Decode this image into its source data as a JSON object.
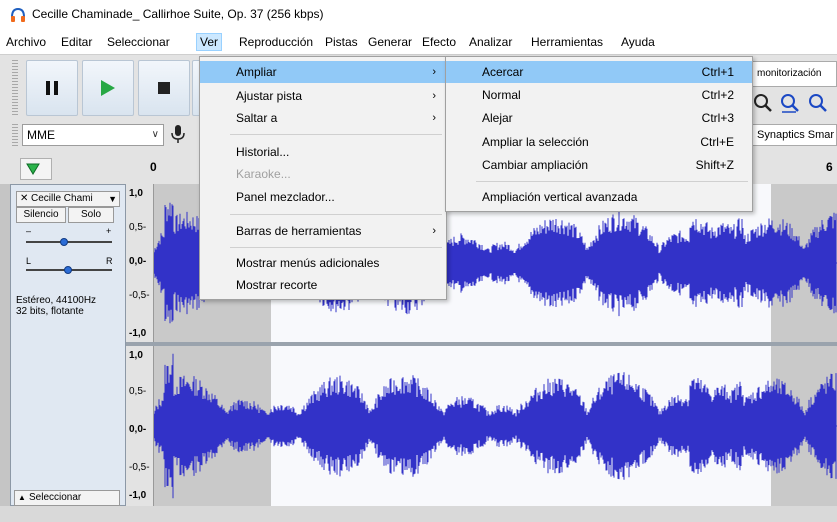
{
  "window": {
    "title": "Cecille Chaminade_ Callirhoe Suite, Op. 37 (256 kbps)"
  },
  "menubar": [
    "Archivo",
    "Editar",
    "Seleccionar",
    "Ver",
    "Reproducción",
    "Pistas",
    "Generar",
    "Efecto",
    "Analizar",
    "Herramientas",
    "Ayuda"
  ],
  "active_menu": "Ver",
  "toolbar": {
    "audio_host": "MME",
    "monitor_label": "monitorización",
    "device_label": "Synaptics Smar"
  },
  "ruler": {
    "labels": [
      "0",
      "6"
    ]
  },
  "ver_menu": {
    "items": [
      {
        "label": "Ampliar",
        "submenu": true,
        "highlighted": true
      },
      {
        "label": "Ajustar pista",
        "submenu": true
      },
      {
        "label": "Saltar a",
        "submenu": true
      },
      {
        "label": "Historial...",
        "submenu": false
      },
      {
        "label": "Karaoke...",
        "submenu": false,
        "disabled": true
      },
      {
        "label": "Panel mezclador...",
        "submenu": false
      },
      {
        "label": "Barras de herramientas",
        "submenu": true
      },
      {
        "label": "Mostrar menús adicionales",
        "submenu": false
      },
      {
        "label": "Mostrar recorte",
        "submenu": false
      }
    ]
  },
  "zoom_submenu": {
    "items": [
      {
        "label": "Acercar",
        "shortcut": "Ctrl+1",
        "highlighted": true
      },
      {
        "label": "Normal",
        "shortcut": "Ctrl+2"
      },
      {
        "label": "Alejar",
        "shortcut": "Ctrl+3"
      },
      {
        "label": "Ampliar la selección",
        "shortcut": "Ctrl+E"
      },
      {
        "label": "Cambiar ampliación",
        "shortcut": "Shift+Z"
      },
      {
        "label": "Ampliación vertical avanzada",
        "shortcut": ""
      }
    ]
  },
  "track": {
    "name": "Cecille Chami",
    "mute_label": "Silencio",
    "solo_label": "Solo",
    "gain_minus": "–",
    "gain_plus": "+",
    "pan_left": "L",
    "pan_right": "R",
    "info_line1": "Estéreo, 44100Hz",
    "info_line2": "32 bits, flotante",
    "select_label": "Seleccionar"
  },
  "vertical_ruler": {
    "ch1": [
      "1,0",
      "0,5-",
      "0,0-",
      "-0,5-",
      "-1,0"
    ],
    "ch2": [
      "1,0",
      "0,5-",
      "0,0-",
      "-0,5-",
      "-1,0"
    ]
  },
  "colors": {
    "waveform": "#3232c8",
    "highlight": "#91c9f7",
    "selection_bg": "#f8f9fc",
    "unselected_bg": "#c9c9c9"
  }
}
